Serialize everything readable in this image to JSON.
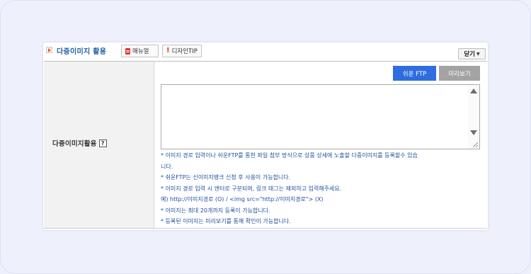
{
  "header": {
    "title": "다중이미지 활용",
    "manual_label": "매뉴얼",
    "tip_label": "디자인TIP",
    "close_label": "닫기"
  },
  "form": {
    "field_label": "다중이미지활용",
    "help_label": "?",
    "ftp_label": "쉬운 FTP",
    "preview_label": "미리보기",
    "textarea_value": "",
    "notes": [
      "* 이미지 경로 입력이나 쉬운FTP를 통한 파일 첨부 방식으로 상품 상세에 노출할 다중이미지를 등록할수 있습",
      "니다.",
      "* 쉬운FTP는 신이미지뱅크 신청 후 사용이 가능합니다.",
      "* 이미지 경로 입력 시 엔터로 구분되며, 링크 태그는 제외하고 입력해주세요.",
      "예) http://이미지경로 (O) / <img src=\"http://이미지경로\"> (X)",
      "* 이미지는 최대 20개까지 등록이 가능합니다.",
      "* 등록된 이미지는 미리보기를 통해 확인이 가능합니다."
    ]
  },
  "colors": {
    "accent": "#2d6de0",
    "title": "#1f5fa8",
    "note_text": "#1f4ea3",
    "label_bg": "#f2f2f2"
  }
}
